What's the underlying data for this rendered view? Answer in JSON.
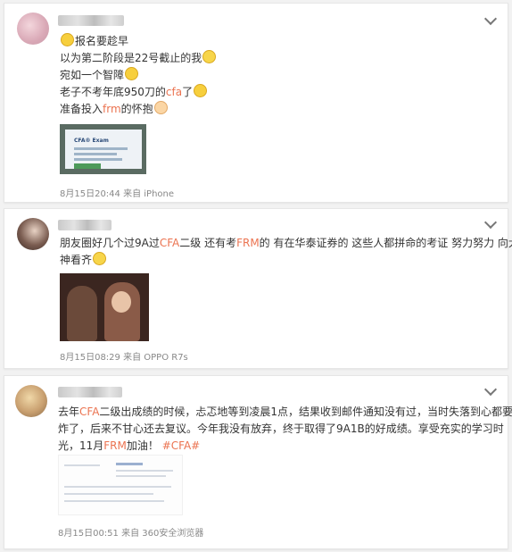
{
  "posts": [
    {
      "lines": [
        {
          "parts": [
            {
              "t": "报名要趁早",
              "hl": false
            }
          ],
          "emoji_before": "smile-emoji"
        },
        {
          "parts": [
            {
              "t": "以为第二阶段是22号截止的我",
              "hl": false
            }
          ],
          "emoji_after": "laugh-cry-emoji"
        },
        {
          "parts": [
            {
              "t": "宛如一个智障",
              "hl": false
            }
          ],
          "emoji_after": "face-emoji"
        },
        {
          "parts": [
            {
              "t": "老子不考年底950刀的",
              "hl": false
            },
            {
              "t": "cfa",
              "hl": true
            },
            {
              "t": "了",
              "hl": false
            }
          ],
          "emoji_after": "grin-emoji"
        },
        {
          "parts": [
            {
              "t": "准备投入",
              "hl": false
            },
            {
              "t": "frm",
              "hl": true
            },
            {
              "t": "的怀抱",
              "hl": false
            }
          ],
          "emoji_after": "hug-emoji"
        }
      ],
      "image_caption": "CFA® Exam",
      "meta": "8月15日20:44 来自 iPhone"
    },
    {
      "lines": [
        {
          "parts": [
            {
              "t": "朋友圈好几个过9A过",
              "hl": false
            },
            {
              "t": "CFA",
              "hl": true
            },
            {
              "t": "二级 还有考",
              "hl": false
            },
            {
              "t": "FRM",
              "hl": true
            },
            {
              "t": "的 有在华泰证券的 这些人都拼命的考证 努力努力 向大",
              "hl": false
            }
          ]
        },
        {
          "parts": [
            {
              "t": "神看齐",
              "hl": false
            }
          ],
          "emoji_after": "cry-emoji"
        }
      ],
      "meta": "8月15日08:29 来自 OPPO R7s"
    },
    {
      "lines": [
        {
          "parts": [
            {
              "t": "去年",
              "hl": false
            },
            {
              "t": "CFA",
              "hl": true
            },
            {
              "t": "二级出成绩的时候，忐忑地等到凌晨1点，结果收到邮件通知没有过，当时失落到心都要",
              "hl": false
            }
          ]
        },
        {
          "parts": [
            {
              "t": "炸了，后来不甘心还去复议。今年我没有放弃，终于取得了9A1B的好成绩。享受充实的学习时",
              "hl": false
            }
          ]
        },
        {
          "parts": [
            {
              "t": "光，11月",
              "hl": false
            },
            {
              "t": "FRM",
              "hl": true
            },
            {
              "t": "加油！ ",
              "hl": false
            },
            {
              "t": "#CFA#",
              "hl": true
            }
          ]
        }
      ],
      "meta": "8月15日00:51 来自 360安全浏览器"
    }
  ],
  "colors": {
    "accent": "#eb7350",
    "meta": "#888888"
  }
}
